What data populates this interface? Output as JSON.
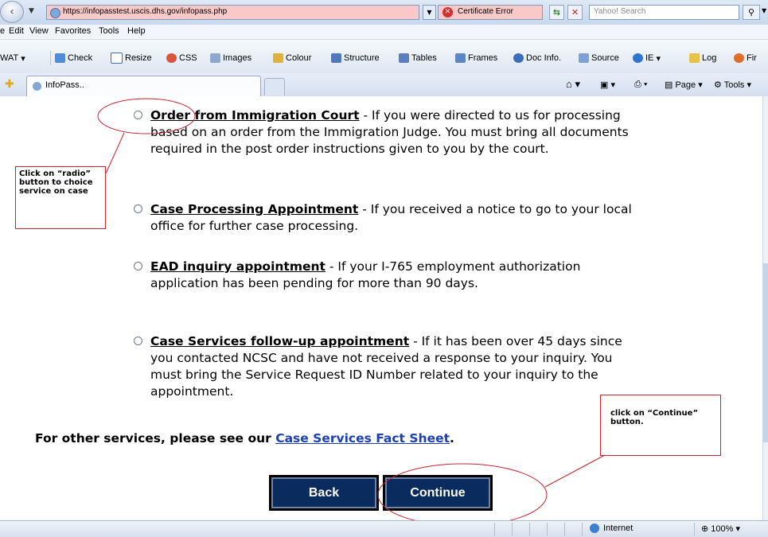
{
  "browser": {
    "address_url": "https://infopasstest.uscis.dhs.gov/infopass.php",
    "certificate_label": "Certificate Error",
    "search_placeholder": "Yahoo! Search",
    "menu": [
      "e",
      "Edit",
      "View",
      "Favorites",
      "Tools",
      "Help"
    ],
    "toolbar": [
      "WAT",
      "Check",
      "Resize",
      "CSS",
      "Images",
      "Colour",
      "Structure",
      "Tables",
      "Frames",
      "Doc Info.",
      "Source",
      "IE",
      "Log",
      "Fir"
    ],
    "tab_title": "InfoPass..",
    "commands": {
      "page": "Page",
      "tools": "Tools"
    }
  },
  "page": {
    "options": [
      {
        "title": "Order from Immigration Court",
        "text": " - If you were directed to us for processing based on an order from the Immigration Judge. You must bring all documents required in the post order instructions given to you by the court."
      },
      {
        "title": "Case Processing Appointment",
        "text": " - If you received a notice to go to your local office for further case processing."
      },
      {
        "title": "EAD inquiry appointment",
        "text": " - If your I-765 employment authorization application has been pending for more than 90 days."
      },
      {
        "title": "Case Services follow-up appointment",
        "text": " - If it has been over 45 days since you contacted NCSC and have not received a response to your inquiry. You must bring the Service Request ID Number related to your inquiry to the appointment."
      }
    ],
    "other_prefix": "For other services, please see our ",
    "other_link": "Case Services Fact Sheet",
    "other_suffix": ".",
    "back_label": "Back",
    "continue_label": "Continue"
  },
  "annotations": {
    "radio_note": "Click on “radio” button to choice service on case",
    "continue_note": "click on “Continue” button."
  },
  "status": {
    "zone": "Internet",
    "zoom": "100%"
  },
  "colors": {
    "annotation_red": "#c8262e",
    "button_navy": "#0a2b5e",
    "link_blue": "#1c3fb3",
    "cert_pink": "#f9c8c8"
  }
}
